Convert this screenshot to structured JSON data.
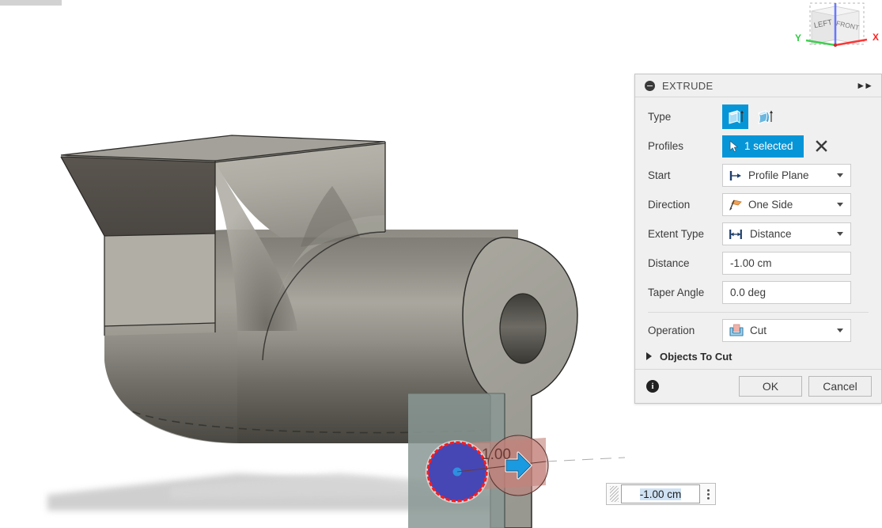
{
  "app": {
    "viewport_background": "#ffffff"
  },
  "viewcube": {
    "face_left_label": "LEFT",
    "face_front_label": "FRONT",
    "axis_x_label": "X",
    "axis_y_label": "Y",
    "axis_z_label": "",
    "axis_x_color": "#ff2222",
    "axis_y_color": "#2ecc40",
    "axis_z_color": "#5566ff"
  },
  "dialog": {
    "title": "EXTRUDE",
    "collapse_icon": "minus-circle-icon",
    "expand_icon": "double-chevron-right-icon",
    "accent_color": "#0696d7",
    "rows": {
      "type": {
        "label": "Type",
        "option_1_name": "extrude-solid-icon",
        "option_2_name": "extrude-taper-icon",
        "selected_index": 0
      },
      "profiles": {
        "label": "Profiles",
        "value": "1 selected",
        "clear_label": "✕"
      },
      "start": {
        "label": "Start",
        "value": "Profile Plane",
        "icon": "profile-plane-icon"
      },
      "direction": {
        "label": "Direction",
        "value": "One Side",
        "icon": "one-side-icon"
      },
      "extent_type": {
        "label": "Extent Type",
        "value": "Distance",
        "icon": "distance-icon"
      },
      "distance": {
        "label": "Distance",
        "value": "-1.00 cm"
      },
      "taper_angle": {
        "label": "Taper Angle",
        "value": "0.0 deg"
      },
      "operation": {
        "label": "Operation",
        "value": "Cut",
        "icon": "cut-operation-icon"
      },
      "objects_to_cut": {
        "label": "Objects To Cut",
        "expanded": false
      }
    },
    "footer": {
      "info_label": "i",
      "ok_label": "OK",
      "cancel_label": "Cancel"
    }
  },
  "canvas": {
    "floating_input": {
      "value": "-1.00 cm",
      "menu_icon": "three-dots-vertical-icon",
      "grip_icon": "drag-grip-icon"
    },
    "manipulator": {
      "dimension_text": "1.00",
      "arrow_icon": "extrude-arrow-handle-icon",
      "profile_fill": "#3d3db5",
      "profile_outline": "#ff1a1a",
      "preview_fill": "#c98c84"
    },
    "model": {
      "description": "meat-grinder-body",
      "body_color": "#9c9a92",
      "shadow_color": "#cfcfcf",
      "sketch_plane_color": "#8a9894"
    }
  }
}
